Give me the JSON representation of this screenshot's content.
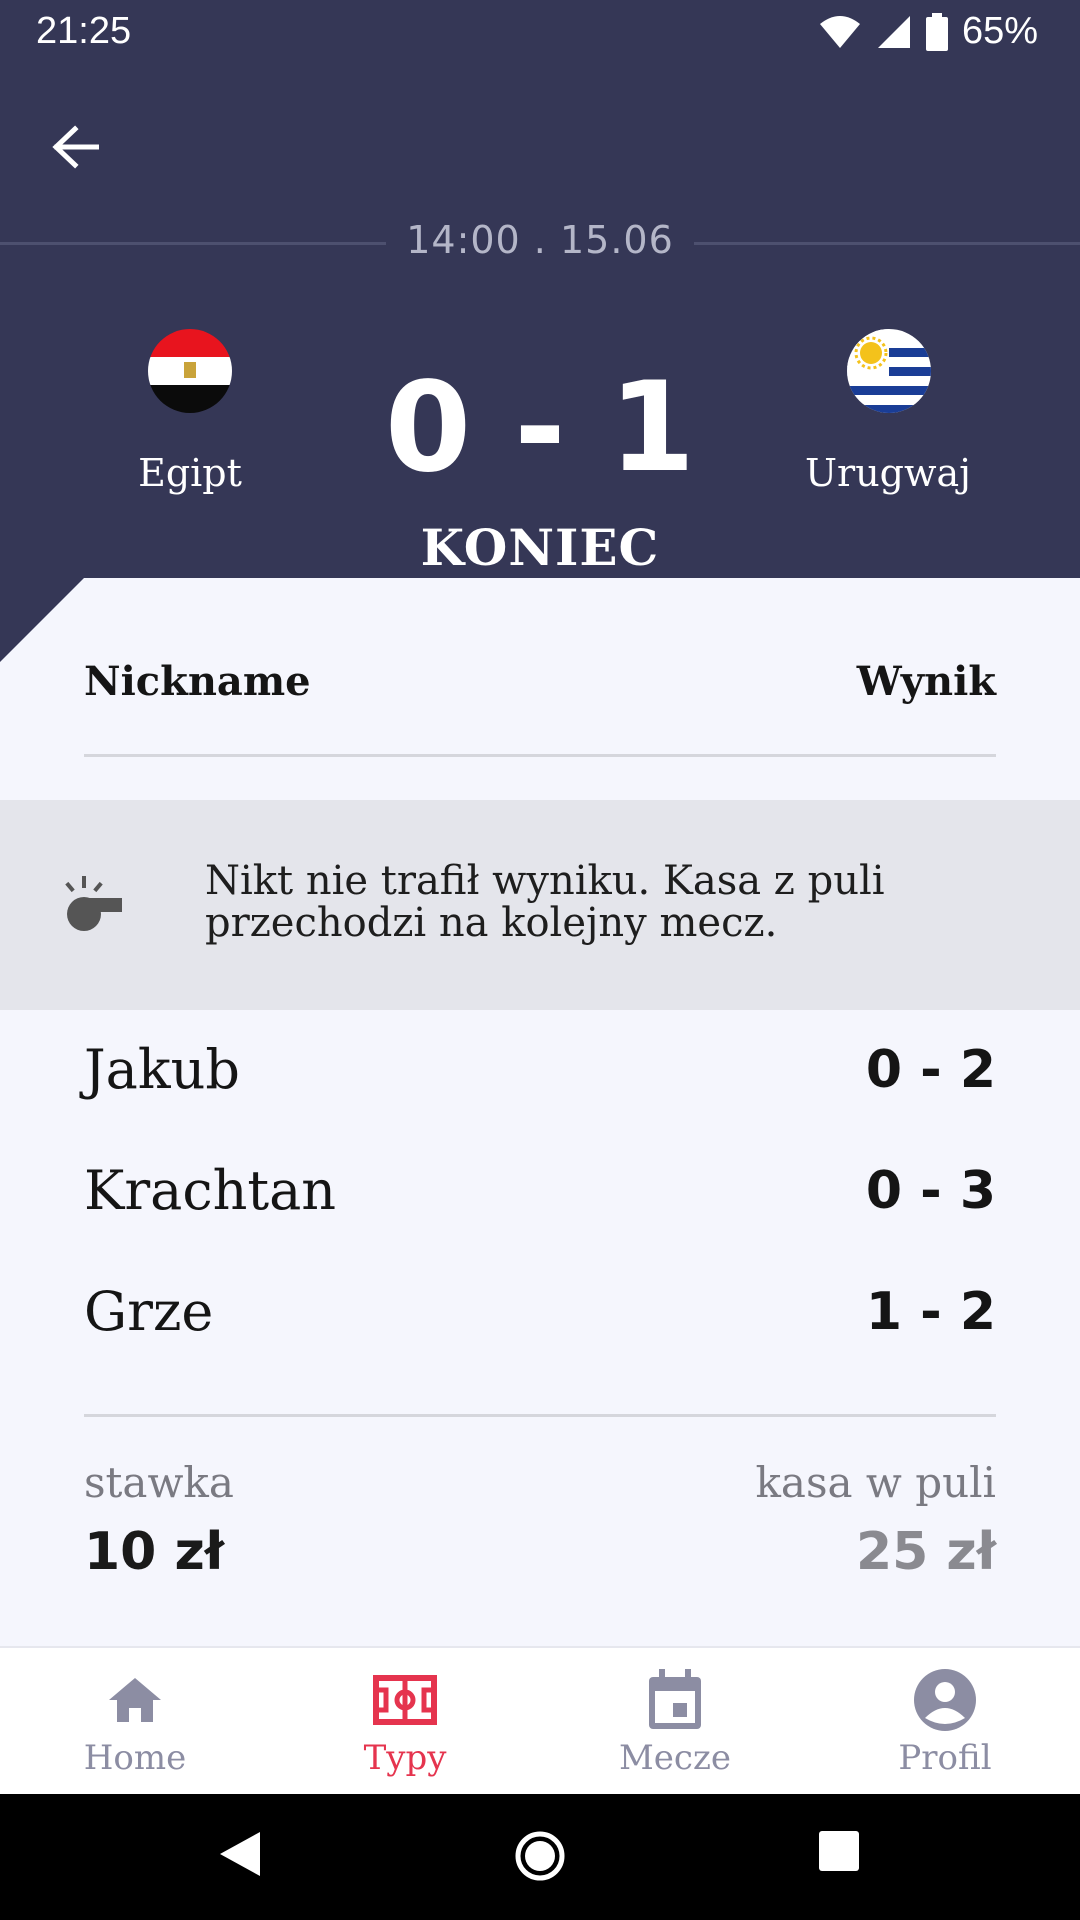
{
  "status_bar": {
    "time": "21:25",
    "battery": "65%"
  },
  "match": {
    "kickoff": "14:00 . 15.06",
    "home_team": "Egipt",
    "away_team": "Urugwaj",
    "score": "0 - 1",
    "status": "KONIEC"
  },
  "table": {
    "col_nickname": "Nickname",
    "col_result": "Wynik",
    "banner": "Nikt nie trafił wyniku. Kasa z puli przechodzi na kolejny mecz.",
    "rows": [
      {
        "nickname": "Jakub",
        "prediction": "0 - 2"
      },
      {
        "nickname": "Krachtan",
        "prediction": "0 - 3"
      },
      {
        "nickname": "Grze",
        "prediction": "1 - 2"
      }
    ]
  },
  "stake": {
    "label": "stawka",
    "value": "10 zł"
  },
  "pool": {
    "label": "kasa w puli",
    "value": "25 zł"
  },
  "nav": {
    "items": [
      {
        "label": "Home",
        "icon": "home-icon"
      },
      {
        "label": "Typy",
        "icon": "pitch-icon",
        "active": true
      },
      {
        "label": "Mecze",
        "icon": "calendar-icon"
      },
      {
        "label": "Profil",
        "icon": "profile-icon"
      }
    ]
  },
  "colors": {
    "header": "#353756",
    "accent": "#e5344e",
    "muted": "#8c8da3"
  }
}
